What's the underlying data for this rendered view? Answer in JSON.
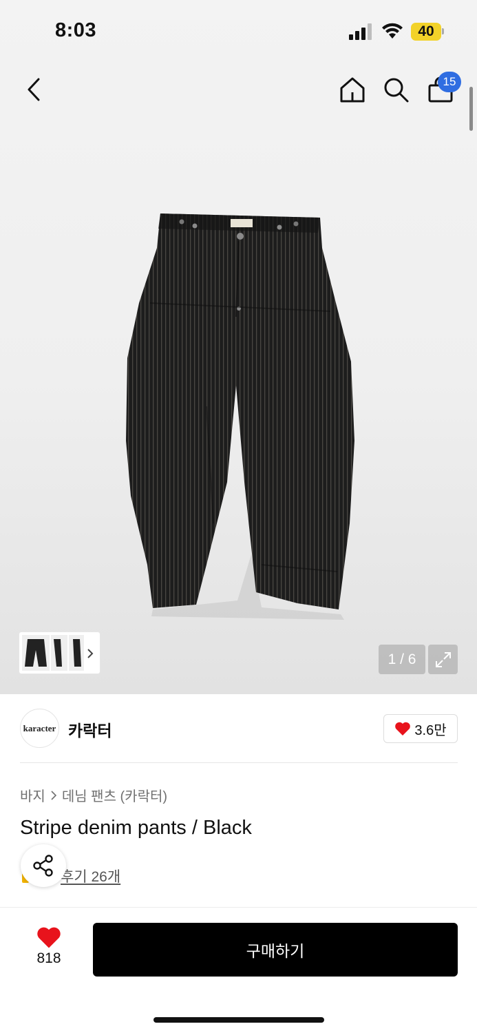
{
  "status_bar": {
    "time": "8:03",
    "battery": "40"
  },
  "header": {
    "back_icon": "chevron-left-icon",
    "home_icon": "home-icon",
    "search_icon": "search-icon",
    "cart_icon": "shopping-bag-icon",
    "cart_badge": "15"
  },
  "gallery": {
    "counter": "1 / 6",
    "thumbs_more_icon": "chevron-right-icon",
    "expand_icon": "expand-icon"
  },
  "brand": {
    "logo_text": "karacter",
    "name": "카락터",
    "like_count": "3.6만"
  },
  "product": {
    "breadcrumb": [
      "바지",
      "데님 팬츠 (카락터)"
    ],
    "title": "Stripe denim pants / Black",
    "reviews": "후기 26개"
  },
  "actions": {
    "share_icon": "share-icon",
    "favorite_count": "818",
    "buy_label": "구매하기"
  },
  "colors": {
    "accent_badge": "#2f6de1",
    "heart": "#e8131c",
    "battery": "#f2d229",
    "buy_button": "#000000"
  }
}
